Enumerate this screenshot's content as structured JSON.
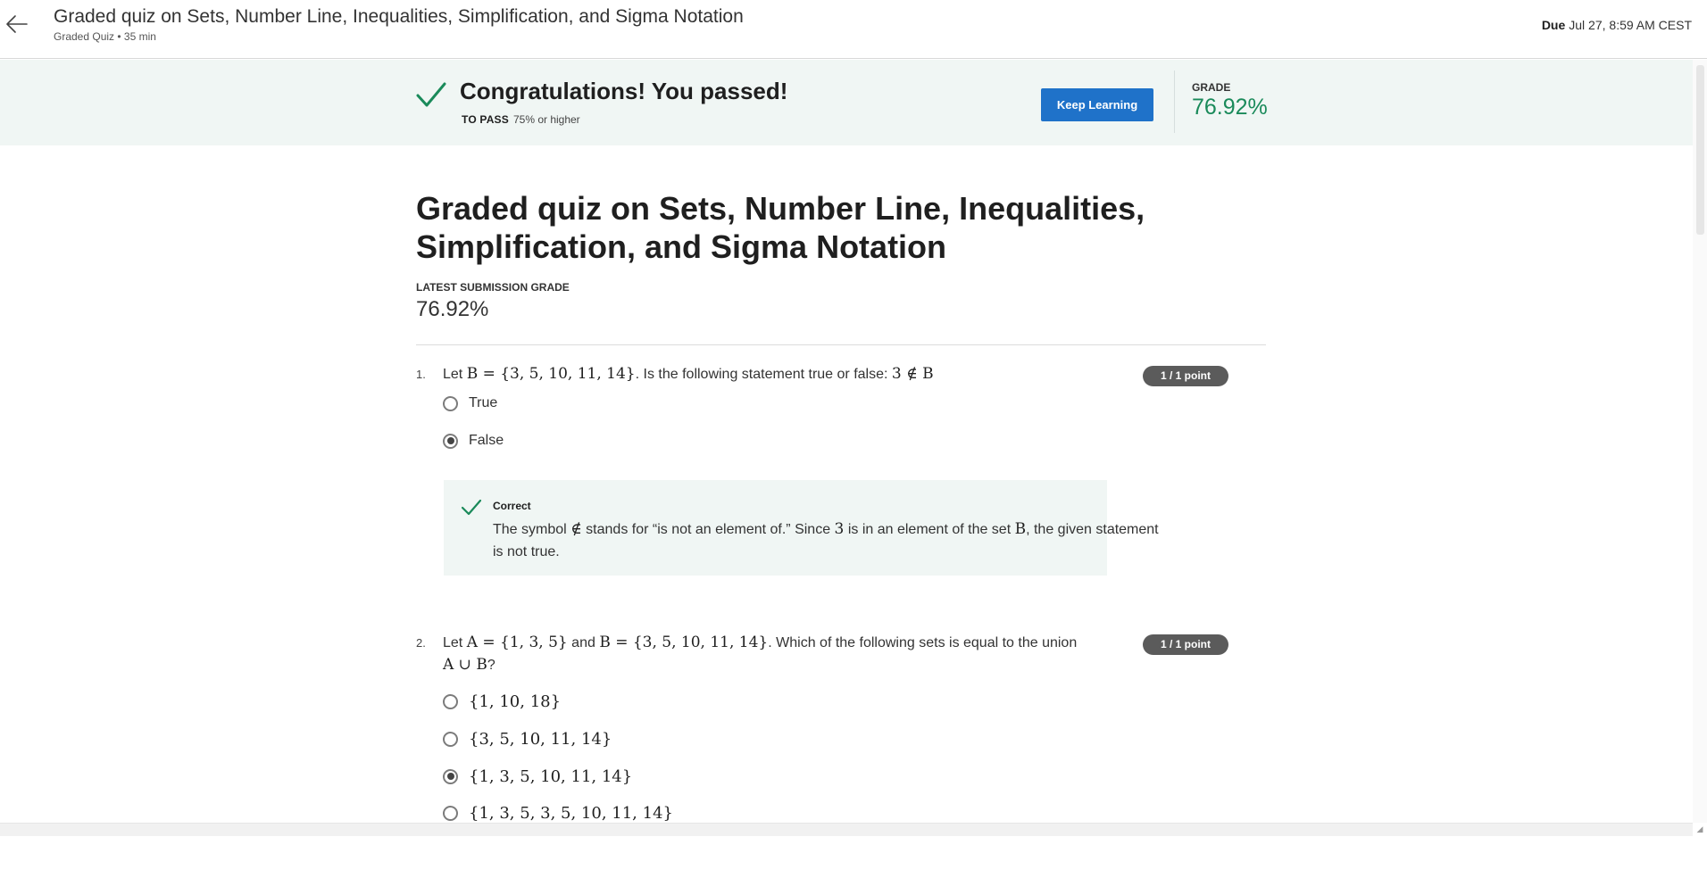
{
  "header": {
    "title": "Graded quiz on Sets, Number Line, Inequalities, Simplification, and Sigma Notation",
    "subtitle": "Graded Quiz • 35 min",
    "due_label": "Due",
    "due_value": "Jul 27, 8:59 AM CEST"
  },
  "banner": {
    "message": "Congratulations! You passed!",
    "to_pass_label": "TO PASS",
    "to_pass_value": "75% or higher",
    "keep_learning_button": "Keep Learning",
    "grade_label": "GRADE",
    "grade_value": "76.92%",
    "accent_color": "#1a8a5a"
  },
  "main": {
    "title": "Graded quiz on Sets, Number Line, Inequalities, Simplification, and Sigma Notation",
    "latest_label": "LATEST SUBMISSION GRADE",
    "latest_value": "76.92%"
  },
  "questions": [
    {
      "number": "1.",
      "text_1": "Let ",
      "math_1": "B = {3, 5, 10, 11, 14}",
      "text_2": ". Is the following statement true or false: ",
      "math_2": "3 ∉ B",
      "points": "1 / 1 point",
      "options": [
        {
          "label": "True",
          "selected": false
        },
        {
          "label": "False",
          "selected": true
        }
      ],
      "feedback": {
        "title": "Correct",
        "t1": "The symbol ",
        "m1": "∉",
        "t2": " stands for “is not an element of.” Since ",
        "m2": "3",
        "t3": " is in an element of the set ",
        "m3": "B",
        "t4": ", the given statement is not true."
      }
    },
    {
      "number": "2.",
      "text_1": "Let ",
      "math_1": "A = {1, 3, 5}",
      "text_2": " and ",
      "math_2": "B = {3, 5, 10, 11, 14}",
      "text_3": ". Which of the following sets is equal to the union ",
      "math_3": "A ∪ B",
      "text_4": "?",
      "points": "1 / 1 point",
      "options": [
        {
          "label": "{1, 10, 18}",
          "selected": false
        },
        {
          "label": "{3, 5, 10, 11, 14}",
          "selected": false
        },
        {
          "label": "{1, 3, 5, 10, 11, 14}",
          "selected": true
        },
        {
          "label": "{1, 3, 5, 3, 5, 10, 11, 14}",
          "selected": false
        }
      ]
    }
  ]
}
